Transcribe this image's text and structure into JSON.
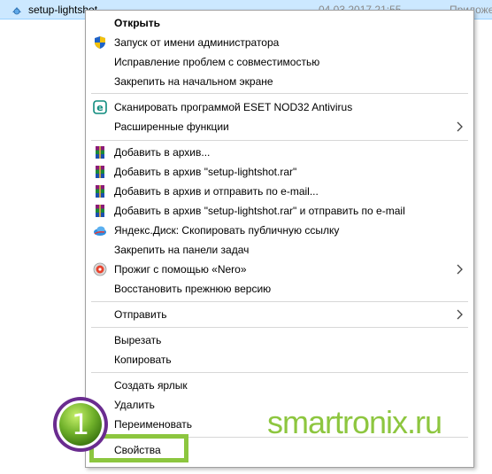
{
  "file": {
    "name": "setup-lightshot",
    "date": "04.03.2017 21:55",
    "type": "Приложение"
  },
  "menu": {
    "open": "Открыть",
    "run_as_admin": "Запуск от имени администратора",
    "troubleshoot": "Исправление проблем с совместимостью",
    "pin_start": "Закрепить на начальном экране",
    "eset_scan": "Сканировать программой ESET NOD32 Antivirus",
    "advanced": "Расширенные функции",
    "add_archive": "Добавить в архив...",
    "add_archive_named": "Добавить в архив \"setup-lightshot.rar\"",
    "add_archive_email": "Добавить в архив и отправить по e-mail...",
    "add_archive_named_email": "Добавить в архив \"setup-lightshot.rar\" и отправить по e-mail",
    "yandex_disk": "Яндекс.Диск: Скопировать публичную ссылку",
    "pin_taskbar": "Закрепить на панели задач",
    "nero_burn": "Прожиг с помощью «Nero»",
    "restore_prev": "Восстановить прежнюю версию",
    "send_to": "Отправить",
    "cut": "Вырезать",
    "copy": "Копировать",
    "create_shortcut": "Создать ярлык",
    "delete": "Удалить",
    "rename": "Переименовать",
    "properties": "Свойства"
  },
  "annotation": {
    "step_number": "1",
    "watermark": "smartronix.ru"
  },
  "colors": {
    "selection": "#cce8ff",
    "highlight_green": "#8cc63f",
    "badge_purple": "#6a2c8f"
  },
  "icons": {
    "file": "setup-file-icon",
    "shield": "uac-shield-icon",
    "eset": "eset-icon",
    "winrar": "winrar-icon",
    "yandex": "yandex-disk-icon",
    "nero": "nero-icon",
    "submenu": "chevron-right-icon"
  }
}
